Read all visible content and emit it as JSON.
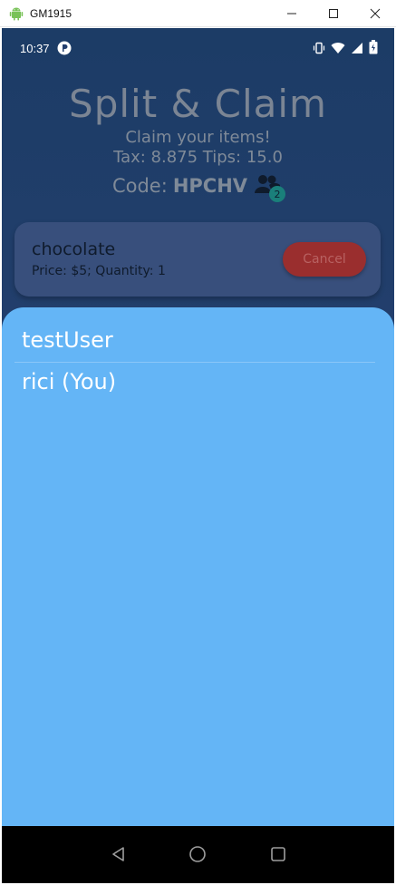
{
  "window": {
    "title": "GM1915",
    "icons": {
      "app": "android-icon",
      "minimize": "minimize-icon",
      "maximize": "maximize-icon",
      "close": "close-icon"
    }
  },
  "statusbar": {
    "time": "10:37",
    "icons": [
      "notification-icon",
      "vibrate-icon",
      "wifi-icon",
      "signal-icon",
      "battery-icon"
    ]
  },
  "header": {
    "title": "Split & Claim",
    "subtitle": "Claim your items!",
    "tax_tips": "Tax: 8.875 Tips: 15.0"
  },
  "code": {
    "label": "Code:",
    "value": "HPCHV",
    "user_count": "2",
    "icon": "group-icon"
  },
  "item": {
    "name": "chocolate",
    "detail": "Price: $5; Quantity: 1",
    "cancel_label": "Cancel"
  },
  "sheet": {
    "users": [
      "testUser",
      "rici (You)"
    ]
  },
  "navbar": {
    "icons": [
      "back-icon",
      "home-icon",
      "recents-icon"
    ]
  },
  "colors": {
    "sheet": "#64b5f6",
    "cancel": "#9a2e2e",
    "badge": "#1a7f7a"
  }
}
